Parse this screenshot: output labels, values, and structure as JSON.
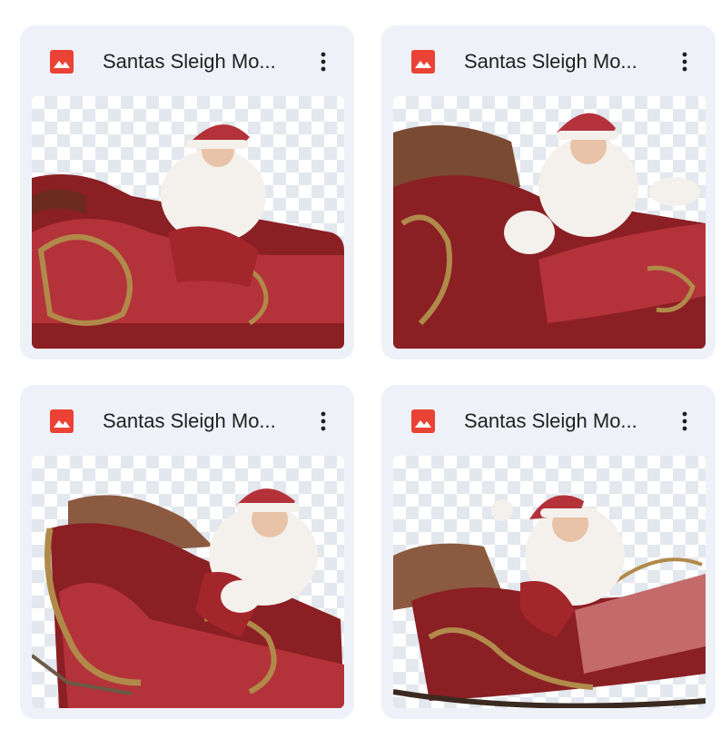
{
  "files": [
    {
      "title": "Santas Sleigh Mo...",
      "icon": "image-file-icon",
      "preview": "santa-sleigh-preview"
    },
    {
      "title": "Santas Sleigh Mo...",
      "icon": "image-file-icon",
      "preview": "santa-sleigh-preview"
    },
    {
      "title": "Santas Sleigh Mo...",
      "icon": "image-file-icon",
      "preview": "santa-sleigh-preview"
    },
    {
      "title": "Santas Sleigh Mo...",
      "icon": "image-file-icon",
      "preview": "santa-sleigh-preview"
    }
  ],
  "colors": {
    "card_background": "#eef2f8",
    "file_icon_red": "#ea4335",
    "title_text": "#1f1f1f",
    "sleigh_red": "#a3262b",
    "gold_trim": "#b08a4a"
  }
}
